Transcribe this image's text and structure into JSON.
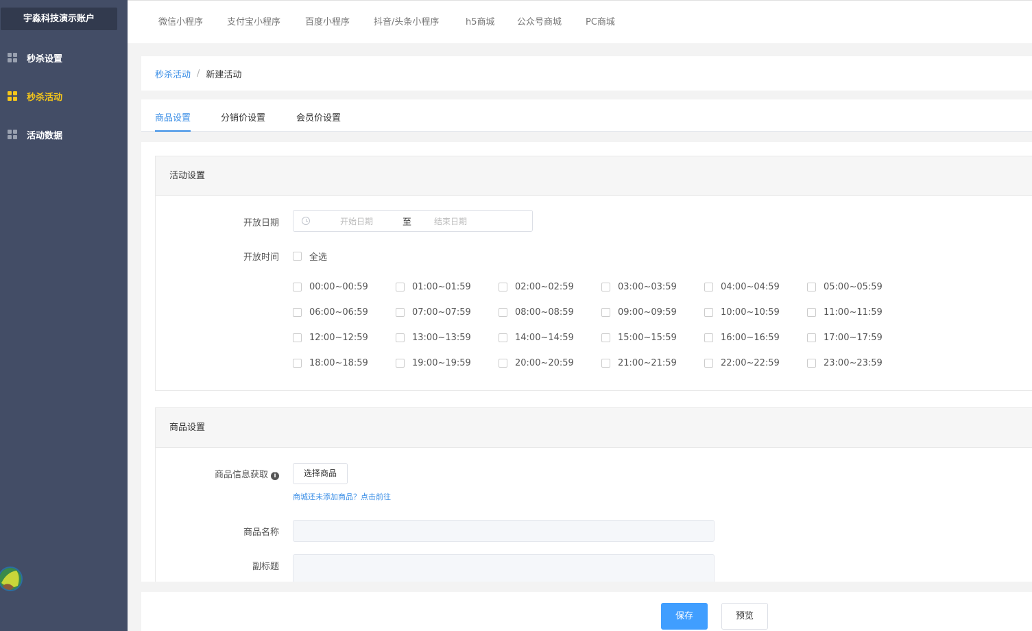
{
  "sidebar": {
    "account_label": "宇淼科技演示账户",
    "items": [
      {
        "label": "秒杀设置",
        "active": false
      },
      {
        "label": "秒杀活动",
        "active": true
      },
      {
        "label": "活动数据",
        "active": false
      }
    ]
  },
  "topnav": {
    "items": [
      "微信小程序",
      "支付宝小程序",
      "百度小程序",
      "抖音/头条小程序",
      "h5商城",
      "公众号商城",
      "PC商城"
    ]
  },
  "breadcrumb": {
    "parent": "秒杀活动",
    "separator": "/",
    "current": "新建活动"
  },
  "tabs": [
    {
      "label": "商品设置",
      "active": true
    },
    {
      "label": "分销价设置",
      "active": false
    },
    {
      "label": "会员价设置",
      "active": false
    }
  ],
  "activity_section": {
    "title": "活动设置",
    "open_date_label": "开放日期",
    "start_placeholder": "开始日期",
    "range_separator": "至",
    "end_placeholder": "结束日期",
    "open_time_label": "开放时间",
    "select_all_label": "全选",
    "time_slots": [
      "00:00~00:59",
      "01:00~01:59",
      "02:00~02:59",
      "03:00~03:59",
      "04:00~04:59",
      "05:00~05:59",
      "06:00~06:59",
      "07:00~07:59",
      "08:00~08:59",
      "09:00~09:59",
      "10:00~10:59",
      "11:00~11:59",
      "12:00~12:59",
      "13:00~13:59",
      "14:00~14:59",
      "15:00~15:59",
      "16:00~16:59",
      "17:00~17:59",
      "18:00~18:59",
      "19:00~19:59",
      "20:00~20:59",
      "21:00~21:59",
      "22:00~22:59",
      "23:00~23:59"
    ]
  },
  "goods_section": {
    "title": "商品设置",
    "info_label": "商品信息获取",
    "info_icon_glyph": "i",
    "select_button": "选择商品",
    "goto_link": "商城还未添加商品？点击前往",
    "name_label": "商品名称",
    "name_value": "",
    "subtitle_label": "副标题",
    "subtitle_value": ""
  },
  "footer": {
    "save_button": "保存",
    "preview_button": "预览"
  },
  "colors": {
    "sidebar_bg": "#434d66",
    "active_yellow": "#f5c61a",
    "primary_blue": "#409eff",
    "link_blue": "#3a8ee6"
  }
}
